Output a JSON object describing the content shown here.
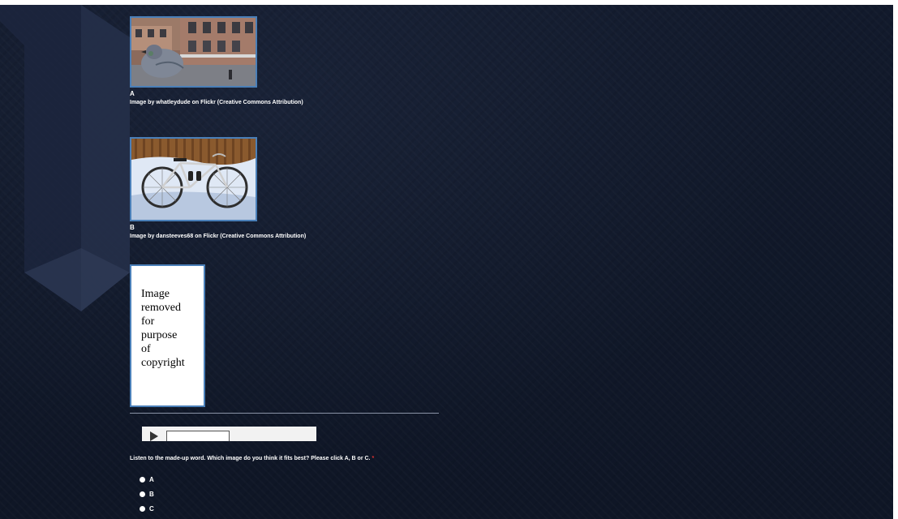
{
  "images": [
    {
      "letter": "A",
      "credit": "Image by whatleydude on Flickr (Creative Commons Attribution)",
      "subject": "pigeon on ledge in front of buildings"
    },
    {
      "letter": "B",
      "credit": "Image by dansteeves68 on Flickr (Creative Commons Attribution)",
      "subject": "bicycle in snow by wooden fence"
    }
  ],
  "removed_image": {
    "lines": [
      "Image",
      "removed",
      "for",
      "purpose",
      "of",
      "copyright"
    ]
  },
  "question": {
    "text": "Listen to the made-up word. Which image do you think it fits best? Please click A, B or C.",
    "required_marker": "*"
  },
  "options": [
    "A",
    "B",
    "C"
  ],
  "colors": {
    "background": "#121a2c",
    "frame": "#4a7fb8",
    "required": "#e03030"
  }
}
